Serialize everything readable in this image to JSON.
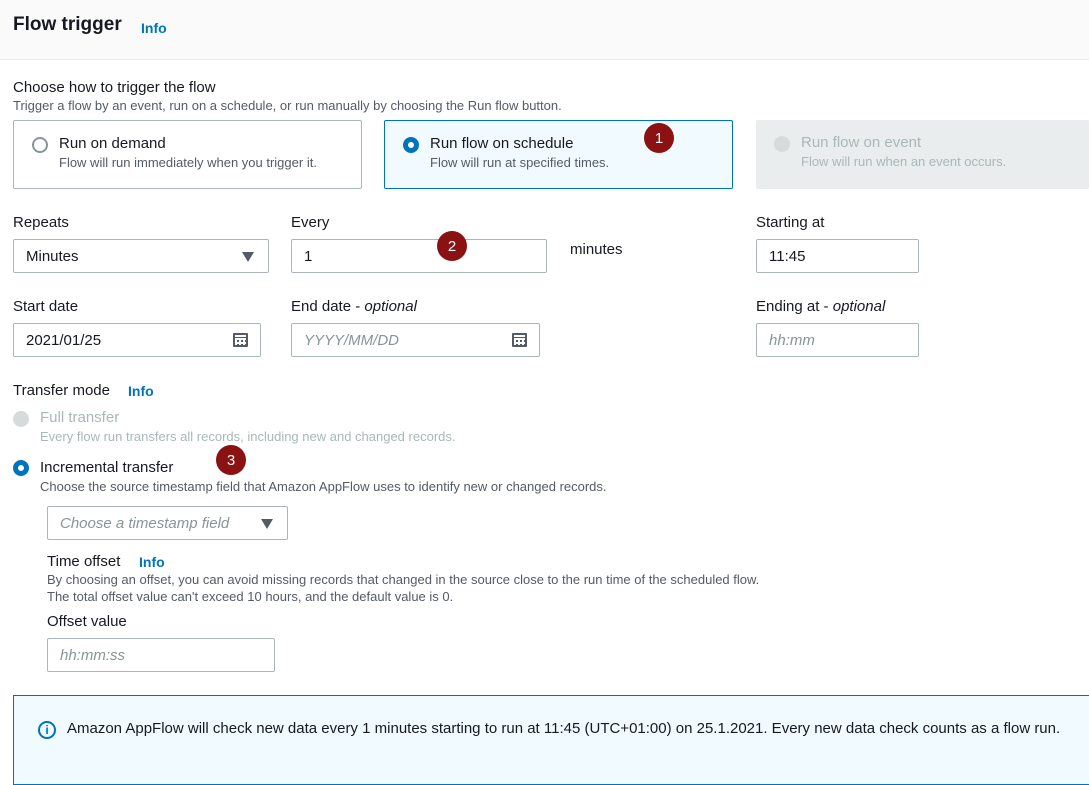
{
  "header": {
    "title": "Flow trigger",
    "info": "Info"
  },
  "trigger": {
    "title": "Choose how to trigger the flow",
    "description": "Trigger a flow by an event, run on a schedule, or run manually by choosing the Run flow button.",
    "options": [
      {
        "title": "Run on demand",
        "description": "Flow will run immediately when you trigger it.",
        "selected": false,
        "disabled": false
      },
      {
        "title": "Run flow on schedule",
        "description": "Flow will run at specified times.",
        "selected": true,
        "disabled": false
      },
      {
        "title": "Run flow on event",
        "description": "Flow will run when an event occurs.",
        "selected": false,
        "disabled": true
      }
    ]
  },
  "schedule": {
    "repeats": {
      "label": "Repeats",
      "value": "Minutes"
    },
    "every": {
      "label": "Every",
      "value": "1",
      "unit": "minutes"
    },
    "starting_at": {
      "label": "Starting at",
      "value": "11:45"
    },
    "start_date": {
      "label": "Start date",
      "value": "2021/01/25"
    },
    "end_date": {
      "label": "End date",
      "optional": "optional",
      "placeholder": "YYYY/MM/DD"
    },
    "ending_at": {
      "label": "Ending at",
      "optional": "optional",
      "placeholder": "hh:mm"
    }
  },
  "transfer": {
    "label": "Transfer mode",
    "info": "Info",
    "full": {
      "title": "Full transfer",
      "description": "Every flow run transfers all records, including new and changed records."
    },
    "incremental": {
      "title": "Incremental transfer",
      "description": "Choose the source timestamp field that Amazon AppFlow uses to identify new or changed records."
    },
    "timestamp_placeholder": "Choose a timestamp field",
    "time_offset": {
      "label": "Time offset",
      "info": "Info",
      "description_1": "By choosing an offset, you can avoid missing records that changed in the source close to the run time of the scheduled flow.",
      "description_2": "The total offset value can't exceed 10 hours, and the default value is 0."
    },
    "offset_value": {
      "label": "Offset value",
      "placeholder": "hh:mm:ss"
    }
  },
  "badges": [
    "1",
    "2",
    "3"
  ],
  "notice": {
    "text": "Amazon AppFlow will check new data every 1 minutes starting to run at 11:45 (UTC+01:00) on 25.1.2021. Every new data check counts as a flow run."
  },
  "colors": {
    "accent": "#0073bb",
    "badge": "#8b1212",
    "selected_tile_bg": "#f1faff"
  }
}
